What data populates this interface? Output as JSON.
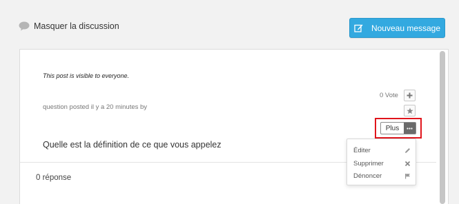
{
  "header": {
    "toggle_label": "Masquer la discussion",
    "new_message_label": "Nouveau message"
  },
  "post": {
    "visibility_note": "This post is visible to everyone.",
    "posted_info": "question posted il y a 20 minutes by",
    "vote_count": "0 Vote",
    "more_label": "Plus",
    "question_title": "Quelle est la définition de ce que vous appelez"
  },
  "menu": {
    "items": [
      {
        "label": "Éditer",
        "icon": "pencil-icon"
      },
      {
        "label": "Supprimer",
        "icon": "cross-icon"
      },
      {
        "label": "Dénoncer",
        "icon": "flag-icon"
      }
    ]
  },
  "answers": {
    "count_label": "0 réponse"
  },
  "colors": {
    "accent": "#33a9e0",
    "highlight": "#e0141b"
  }
}
